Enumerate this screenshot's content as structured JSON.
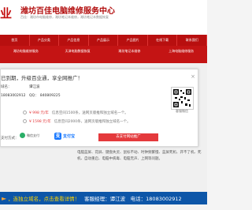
{
  "header": {
    "logo": "业",
    "title": "潍坊百佳电脑维修服务中心",
    "subtitle": "百佳：潍坊市电脑维修，潍坊笔记本维修，潍坊笔记本数据恢复"
  },
  "nav": [
    "首页",
    "产品分类",
    "产品信息",
    "产品展示",
    "产品图片",
    "在线下载",
    "联系我们"
  ],
  "categories": [
    "潍坊电脑维修服务",
    "天津电脑数据恢复",
    "潍坊笔记本维修",
    "上海电脑维修服务"
  ],
  "modal": {
    "title": "已到期，升级百业通，享全网推广！",
    "close": "×",
    "domain_label": "域名：",
    "domain_value": "谭江波",
    "contact_line": "18083002912　QQ：　840809225",
    "qr_label": "客服微信",
    "options": [
      {
        "price": "¥ 998 元/年",
        "desc": "信息空间1500条，送网页版推和独立域名一个。"
      },
      {
        "price": "¥ 1598 元/年",
        "desc": "信息空间2000条，送网页版推和独立域名一个。"
      }
    ],
    "pay_label": "支付方式：",
    "wechat_label": "微信支付",
    "alipay_label": "支付宝",
    "pay_button": "去支付网站推广"
  },
  "content_text": "电脑蓝屏、花屏、键盘失灵、鼠标不动、时钟频繁慢、蓝屏死机、开不了机、死机、自动重启、电脑中病毒、电脑无声、上网等问题。",
  "bottom": {
    "promo": "，连独立域名，点击查看详情！",
    "contact": "客服经理：谭江波　电话：18083002912"
  }
}
